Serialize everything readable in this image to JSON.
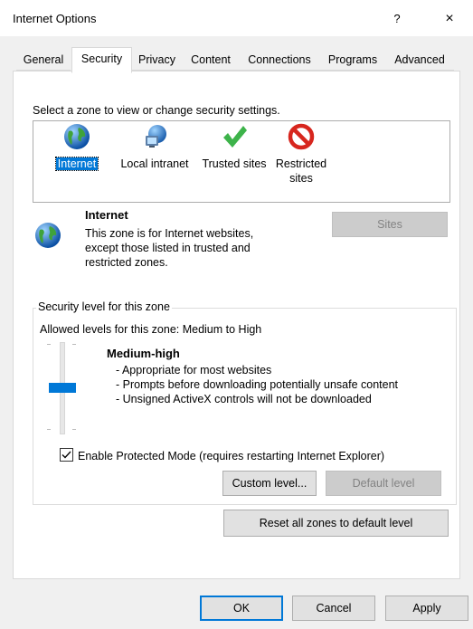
{
  "window": {
    "title": "Internet Options",
    "help": "?",
    "close": "×"
  },
  "tabs": [
    {
      "label": "General"
    },
    {
      "label": "Security"
    },
    {
      "label": "Privacy"
    },
    {
      "label": "Content"
    },
    {
      "label": "Connections"
    },
    {
      "label": "Programs"
    },
    {
      "label": "Advanced"
    }
  ],
  "active_tab": "Security",
  "zones_prompt": "Select a zone to view or change security settings.",
  "zones": [
    {
      "label": "Internet",
      "icon": "globe-icon",
      "selected": true
    },
    {
      "label": "Local intranet",
      "icon": "network-icon"
    },
    {
      "label": "Trusted sites",
      "icon": "checkmark-icon"
    },
    {
      "label": "Restricted sites",
      "label_line1": "Restricted",
      "label_line2": "sites",
      "icon": "prohibited-icon"
    }
  ],
  "zone_info": {
    "name": "Internet",
    "description": "This zone is for Internet websites, except those listed in trusted and restricted zones.",
    "sites_button": "Sites"
  },
  "security_level": {
    "group_title": "Security level for this zone",
    "allowed": "Allowed levels for this zone: Medium to High",
    "level_name": "Medium-high",
    "bullets": [
      "- Appropriate for most websites",
      "- Prompts before downloading potentially unsafe content",
      "- Unsigned ActiveX controls will not be downloaded"
    ],
    "slider_level_fraction": 0.5,
    "protected_mode_label": "Enable Protected Mode (requires restarting Internet Explorer)",
    "protected_mode_checked": true,
    "custom_level_button": "Custom level...",
    "default_level_button": "Default level"
  },
  "reset_button": "Reset all zones to default level",
  "footer": {
    "ok": "OK",
    "cancel": "Cancel",
    "apply": "Apply"
  },
  "colors": {
    "accent": "#0078d7",
    "dialog_bg": "#f0f0f0",
    "button_bg": "#e1e1e1",
    "disabled_text": "#838383"
  }
}
